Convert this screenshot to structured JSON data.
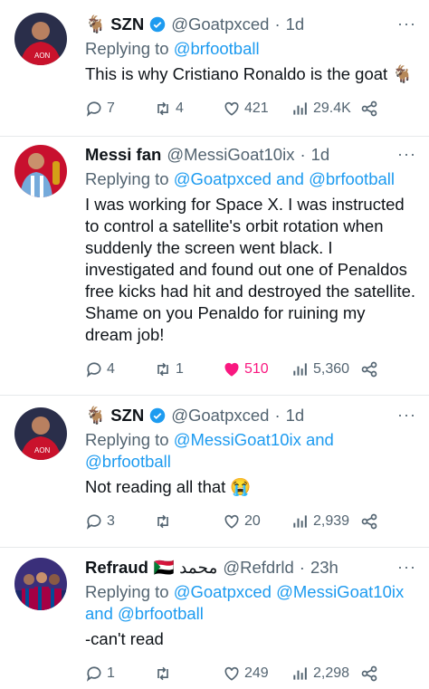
{
  "tweets": [
    {
      "name": "SZN",
      "name_emoji": "🐐",
      "verified": true,
      "handle": "@Goatpxced",
      "time": "1d",
      "replying_prefix": "Replying to",
      "replying_to": "@brfootball",
      "text": "This is why Cristiano Ronaldo is the goat 🐐",
      "replies": "7",
      "retweets": "4",
      "likes": "421",
      "views": "29.4K"
    },
    {
      "name": "Messi fan",
      "handle": "@MessiGoat10ix",
      "time": "1d",
      "replying_prefix": "Replying to",
      "replying_to": "@Goatpxced and @brfootball",
      "text": "I was working for Space X. I was instructed to control a satellite's orbit rotation when suddenly the screen went black. I investigated and found out one of Penaldos free kicks had hit and destroyed the satellite. Shame on you Penaldo for ruining my dream job!",
      "replies": "4",
      "retweets": "1",
      "likes": "510",
      "liked": true,
      "views": "5,360"
    },
    {
      "name": "SZN",
      "name_emoji": "🐐",
      "verified": true,
      "handle": "@Goatpxced",
      "time": "1d",
      "replying_prefix": "Replying to",
      "replying_to": "@MessiGoat10ix and @brfootball",
      "text": "Not reading all that 😭",
      "replies": "3",
      "retweets": "",
      "likes": "20",
      "views": "2,939"
    },
    {
      "name": "Refraud",
      "name_suffix": "🇸🇩 محمد",
      "handle": "@Refdrld",
      "time": "23h",
      "replying_prefix": "Replying to",
      "replying_to": "@Goatpxced @MessiGoat10ix and @brfootball",
      "text": "-can't read",
      "replies": "1",
      "retweets": "",
      "likes": "249",
      "views": "2,298"
    }
  ],
  "colors": {
    "link": "#1d9bf0",
    "muted": "#536471",
    "like_active": "#f91880",
    "divider": "#e6e9eb"
  },
  "icons": [
    "more-icon",
    "verified-icon",
    "reply-icon",
    "retweet-icon",
    "like-icon",
    "views-icon",
    "share-icon"
  ]
}
